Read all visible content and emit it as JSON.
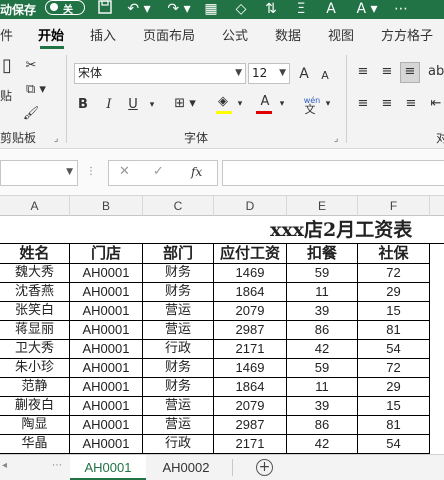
{
  "titlebar": {
    "autosave_label": "动保存",
    "toggle_state": "关",
    "icons": [
      "save-icon",
      "undo-icon",
      "redo-icon",
      "format-icon",
      "sort-icon",
      "font-color-icon",
      "dropdown-icon"
    ]
  },
  "tabs": [
    {
      "label": "件",
      "active": false
    },
    {
      "label": "开始",
      "active": true
    },
    {
      "label": "插入",
      "active": false
    },
    {
      "label": "页面布局",
      "active": false
    },
    {
      "label": "公式",
      "active": false
    },
    {
      "label": "数据",
      "active": false
    },
    {
      "label": "视图",
      "active": false
    },
    {
      "label": "方方格子",
      "active": false
    }
  ],
  "ribbon": {
    "clipboard": {
      "paste_label": "贴",
      "group_label": "剪贴板"
    },
    "font": {
      "name": "宋体",
      "size": "12",
      "bold": "B",
      "italic": "I",
      "underline": "U",
      "grow": "A",
      "shrink": "A",
      "wen": "wén",
      "group_label": "字体",
      "highlight_color": "#ffff00",
      "font_color": "#e00000"
    },
    "align_group_label_partial": "对"
  },
  "formula_bar": {
    "cancel": "✕",
    "confirm": "✓",
    "fx": "fx",
    "value": ""
  },
  "grid": {
    "columns": [
      "A",
      "B",
      "C",
      "D",
      "E",
      "F"
    ],
    "title": "xxx店2月工资表",
    "headers": [
      "姓名",
      "门店",
      "部门",
      "应付工资",
      "扣餐",
      "社保"
    ],
    "rows": [
      [
        "魏大秀",
        "AH0001",
        "财务",
        "1469",
        "59",
        "72"
      ],
      [
        "沈香燕",
        "AH0001",
        "财务",
        "1864",
        "11",
        "29"
      ],
      [
        "张笑白",
        "AH0001",
        "营运",
        "2079",
        "39",
        "15"
      ],
      [
        "蒋显丽",
        "AH0001",
        "营运",
        "2987",
        "86",
        "81"
      ],
      [
        "卫大秀",
        "AH0001",
        "行政",
        "2171",
        "42",
        "54"
      ],
      [
        "朱小珍",
        "AH0001",
        "财务",
        "1469",
        "59",
        "72"
      ],
      [
        "范静",
        "AH0001",
        "财务",
        "1864",
        "11",
        "29"
      ],
      [
        "蒯夜白",
        "AH0001",
        "营运",
        "2079",
        "39",
        "15"
      ],
      [
        "陶显",
        "AH0001",
        "营运",
        "2987",
        "86",
        "81"
      ],
      [
        "华晶",
        "AH0001",
        "行政",
        "2171",
        "42",
        "54"
      ]
    ]
  },
  "sheets": [
    {
      "label": "AH0001",
      "active": true
    },
    {
      "label": "AH0002",
      "active": false
    }
  ],
  "add_sheet": "+",
  "accent_color": "#217346"
}
